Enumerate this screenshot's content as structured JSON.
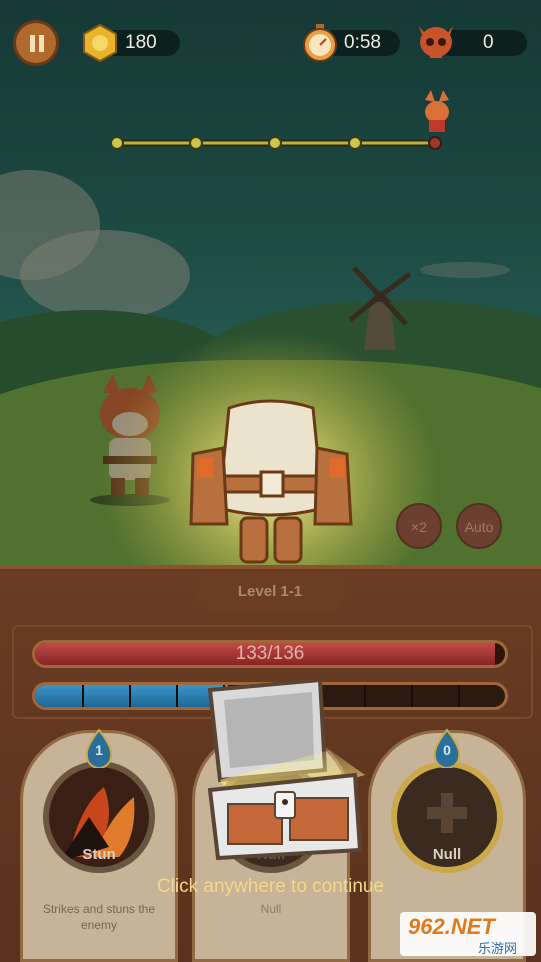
{
  "hud": {
    "coins": "180",
    "timer": "0:58",
    "kills": "0"
  },
  "progress": {
    "nodes": 5,
    "current_node_fraction": 1.0
  },
  "battle": {
    "x2_label": "×2",
    "auto_label": "Auto"
  },
  "level": {
    "label": "Level 1-1"
  },
  "player": {
    "hp_text": "133/136",
    "hp_fraction": 0.978,
    "mana_fraction": 0.41
  },
  "skills": [
    {
      "name": "Stun",
      "cost": "1",
      "description": "Strikes and stuns the enemy"
    },
    {
      "name": "Null",
      "cost": "",
      "description": "Null"
    },
    {
      "name": "Null",
      "cost": "0",
      "description": ""
    }
  ],
  "reward": {
    "prompt": "Click anywhere to continue"
  },
  "watermark": {
    "brand": "962.NET",
    "subtitle": "乐游网"
  },
  "colors": {
    "hp": "#a83232",
    "mana": "#2b7fb3",
    "panel": "#5e351f",
    "prompt": "#f5d88a"
  }
}
